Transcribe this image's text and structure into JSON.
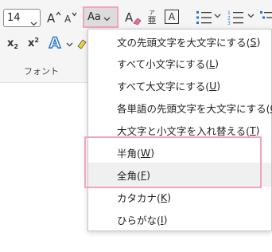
{
  "ribbon": {
    "font_size": "14",
    "case_button_label": "Aa",
    "group_label": "フォント",
    "furigana_glyph": "ア",
    "furigana_sub": "亜",
    "char_border_glyph": "A",
    "subscript_glyph": "x",
    "subscript_mark": "2",
    "superscript_glyph": "x",
    "superscript_mark": "2",
    "text_effect_glyph": "A"
  },
  "menu": {
    "items": [
      {
        "label": "文の先頭文字を大文字にする(",
        "key": "S",
        "close": ")"
      },
      {
        "label": "すべて小文字にする(",
        "key": "L",
        "close": ")"
      },
      {
        "label": "すべて大文字にする(",
        "key": "U",
        "close": ")"
      },
      {
        "label": "各単語の先頭文字を大文字にする(",
        "key": "C",
        "close": ")"
      },
      {
        "label": "大文字と小文字を入れ替える(",
        "key": "T",
        "close": ")"
      },
      {
        "label": "半角(",
        "key": "W",
        "close": ")"
      },
      {
        "label": "全角(",
        "key": "F",
        "close": ")"
      },
      {
        "label": "カタカナ(",
        "key": "K",
        "close": ")"
      },
      {
        "label": "ひらがな(",
        "key": "I",
        "close": ")"
      }
    ]
  },
  "colors": {
    "highlight_border": "#f0a3c3",
    "text_effect_blue": "#2b73c9"
  }
}
